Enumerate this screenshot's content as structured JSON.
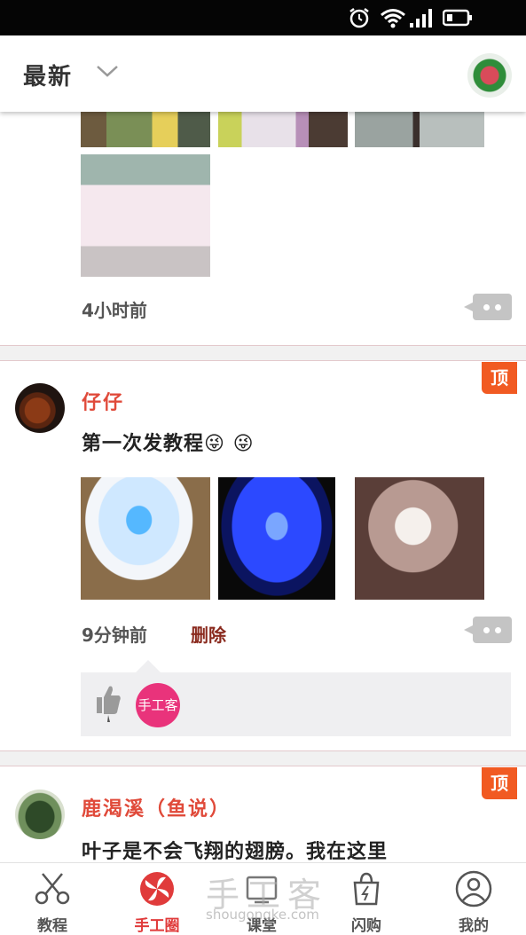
{
  "topbar": {
    "title": "最新"
  },
  "posts": [
    {
      "time": "4小时前"
    },
    {
      "pinned_label": "顶",
      "username": "仔仔",
      "text": "第一次发教程😜 😜",
      "time": "9分钟前",
      "delete_label": "删除",
      "like_badge": "手工客"
    },
    {
      "pinned_label": "顶",
      "username": "鹿渴溪（鱼说）",
      "text": "叶子是不会飞翔的翅膀。我在这里"
    }
  ],
  "tabs": [
    {
      "label": "教程",
      "icon": "scissors-icon"
    },
    {
      "label": "手工圈",
      "icon": "pinwheel-icon",
      "active": true
    },
    {
      "label": "课堂",
      "icon": "classroom-icon"
    },
    {
      "label": "闪购",
      "icon": "shopping-bag-icon"
    },
    {
      "label": "我的",
      "icon": "profile-icon"
    }
  ],
  "watermark": {
    "text": "手工客",
    "url": "shougongke.com"
  },
  "colors": {
    "accent": "#e03b3b",
    "pin": "#f15a22",
    "username": "#e04a3a",
    "like": "#e9337b"
  }
}
